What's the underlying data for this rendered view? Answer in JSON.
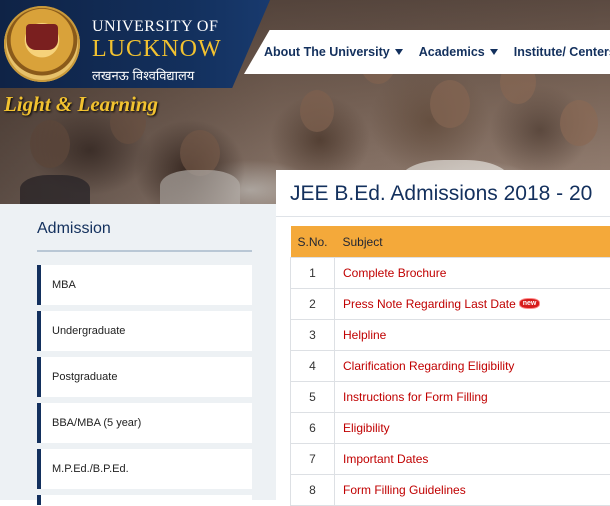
{
  "header": {
    "university_line1": "UNIVERSITY OF",
    "university_line2": "LUCKNOW",
    "university_hindi": "लखनऊ विश्वविद्यालय",
    "tagline": "Light & Learning"
  },
  "nav": {
    "items": [
      {
        "label": "About The University"
      },
      {
        "label": "Academics"
      },
      {
        "label": "Institute/ Centers"
      }
    ]
  },
  "sidebar": {
    "title": "Admission",
    "items": [
      {
        "label": "MBA"
      },
      {
        "label": "Undergraduate"
      },
      {
        "label": "Postgraduate"
      },
      {
        "label": "BBA/MBA (5 year)"
      },
      {
        "label": "M.P.Ed./B.P.Ed."
      }
    ]
  },
  "main": {
    "title": "JEE B.Ed. Admissions 2018 - 20",
    "table": {
      "headers": {
        "sno": "S.No.",
        "subject": "Subject"
      },
      "new_badge": "new",
      "rows": [
        {
          "sno": "1",
          "subject": "Complete Brochure"
        },
        {
          "sno": "2",
          "subject": "Press Note Regarding Last Date"
        },
        {
          "sno": "3",
          "subject": "Helpline"
        },
        {
          "sno": "4",
          "subject": "Clarification Regarding Eligibility"
        },
        {
          "sno": "5",
          "subject": "Instructions for Form Filling"
        },
        {
          "sno": "6",
          "subject": "Eligibility"
        },
        {
          "sno": "7",
          "subject": "Important Dates"
        },
        {
          "sno": "8",
          "subject": "Form Filling Guidelines"
        }
      ]
    }
  }
}
